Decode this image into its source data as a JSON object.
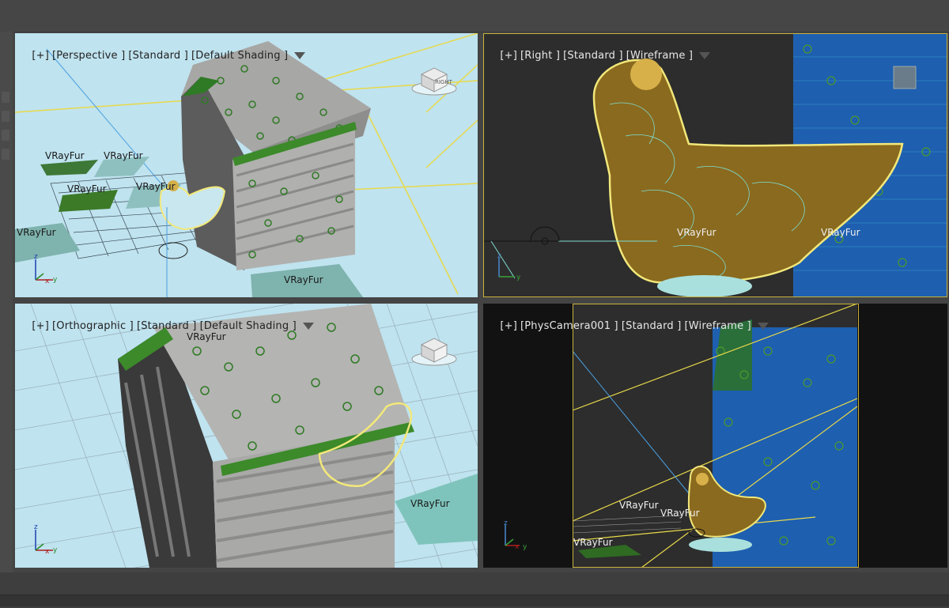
{
  "viewports": {
    "perspective": {
      "label_plus": "[+]",
      "label_view": "[Perspective ]",
      "label_mode": "[Standard ]",
      "label_shading": "[Default Shading ]",
      "fur_labels": [
        "VRayFur",
        "VRayFur",
        "VRayFur",
        "VRayFur",
        "VRayFur",
        "VRayFur"
      ],
      "viewcube_text": "RIGHT"
    },
    "right": {
      "label_plus": "[+]",
      "label_view": "[Right ]",
      "label_mode": "[Standard ]",
      "label_shading": "[Wireframe ]",
      "fur_labels": [
        "VRayFur",
        "VRayFur"
      ]
    },
    "orthographic": {
      "label_plus": "[+]",
      "label_view": "[Orthographic ]",
      "label_mode": "[Standard ]",
      "label_shading": "[Default Shading ]",
      "fur_labels": [
        "VRayFur",
        "VRayFur"
      ]
    },
    "camera": {
      "label_plus": "[+]",
      "label_view": "[PhysCamera001 ]",
      "label_mode": "[Standard ]",
      "label_shading": "[Wireframe ]",
      "fur_labels": [
        "VRayFur",
        "VRayFur",
        "VRayFur"
      ]
    }
  },
  "axis": {
    "x": "x",
    "y": "y",
    "z": "z"
  },
  "colors": {
    "viewport_bg_light": "#bfe3ef",
    "viewport_bg_dark": "#2d2d2d",
    "active_border": "#c8b23c",
    "fur_green": "#3c8a2a",
    "wire_blue": "#1e5fb0",
    "bird_brown": "#8a6a1e",
    "selection_yellow": "#f2e87a"
  },
  "icons": [
    "filter-icon",
    "viewcube-icon",
    "axis-tripod-icon",
    "camera-target-icon"
  ]
}
